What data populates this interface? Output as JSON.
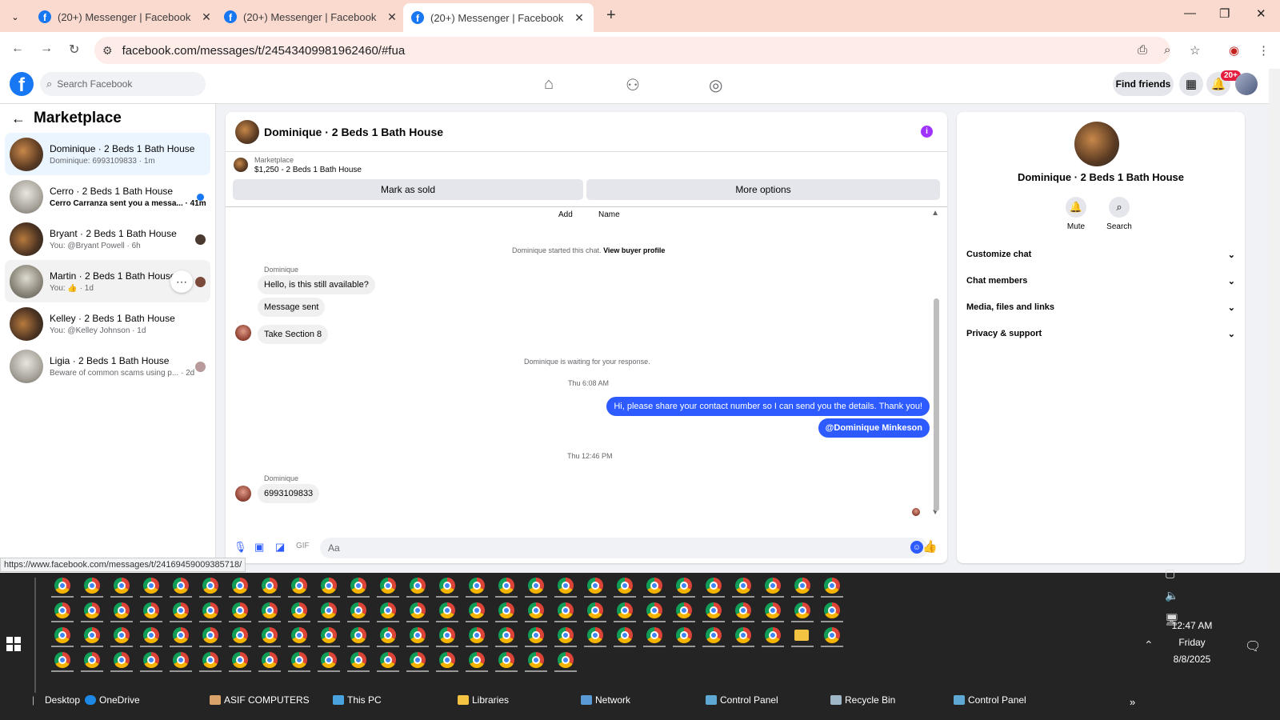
{
  "browser": {
    "tabs": [
      {
        "title": "(20+) Messenger | Facebook",
        "close": "✕"
      },
      {
        "title": "(20+) Messenger | Facebook",
        "close": "✕"
      },
      {
        "title": "(20+) Messenger | Facebook",
        "close": "✕"
      }
    ],
    "new_tab": "+",
    "url": "facebook.com/messages/t/24543409981962460/#fua",
    "status_url": "https://www.facebook.com/messages/t/24169459009385718/"
  },
  "facebook": {
    "search_placeholder": "Search Facebook",
    "find_friends": "Find friends",
    "notif_badge": "20+"
  },
  "sidebar": {
    "title": "Marketplace",
    "conversations": [
      {
        "name": "Dominique · 2 Beds 1 Bath House",
        "preview": "Dominique: 6993109833 · 1m"
      },
      {
        "name": "Cerro · 2 Beds 1 Bath House",
        "preview": "Cerro Carranza sent you a messa... · 41m"
      },
      {
        "name": "Bryant · 2 Beds 1 Bath House",
        "preview": "You: @Bryant Powell · 6h"
      },
      {
        "name": "Martin · 2 Beds 1 Bath House",
        "preview": "You: 👍 · 1d"
      },
      {
        "name": "Kelley · 2 Beds 1 Bath House",
        "preview": "You: @Kelley Johnson · 1d"
      },
      {
        "name": "Ligia · 2 Beds 1 Bath House",
        "preview": "Beware of common scams using p... · 2d"
      }
    ]
  },
  "chat": {
    "header_name": "Dominique · 2 Beds 1 Bath House",
    "marketplace_label": "Marketplace",
    "listing": "$1,250 - 2 Beds 1 Bath House",
    "mark_sold": "Mark as sold",
    "more_options": "More options",
    "add_label": "Add",
    "name_label": "Name",
    "started_text": "Dominique started this chat.",
    "view_profile": "View buyer profile",
    "sender1": "Dominique",
    "msg1": "Hello, is this still available?",
    "msg2": "Message sent",
    "msg3": "Take Section 8",
    "waiting": "Dominique is waiting for your response.",
    "time1": "Thu 6:08 AM",
    "out1": "Hi, please share your contact number so I can send you the details. Thank you!",
    "out2": "@Dominique Minkeson",
    "time2": "Thu 12:46 PM",
    "sender2": "Dominique",
    "msg4": "6993109833",
    "composer_placeholder": "Aa"
  },
  "details": {
    "name": "Dominique · 2 Beds 1 Bath House",
    "mute": "Mute",
    "search": "Search",
    "sections": [
      "Customize chat",
      "Chat members",
      "Media, files and links",
      "Privacy & support"
    ]
  },
  "taskbar": {
    "clock_time": "12:47 AM",
    "clock_day": "Friday",
    "clock_date": "8/8/2025",
    "desktop": "Desktop",
    "items": [
      "OneDrive",
      "ASIF COMPUTERS",
      "This PC",
      "Libraries",
      "Network",
      "Control Panel",
      "Recycle Bin",
      "Control Panel"
    ],
    "more": "»"
  },
  "colors": {
    "facebook_blue": "#1877f2",
    "outgoing_bubble": "#2d5bff",
    "tab_bar": "#fad9cf"
  }
}
